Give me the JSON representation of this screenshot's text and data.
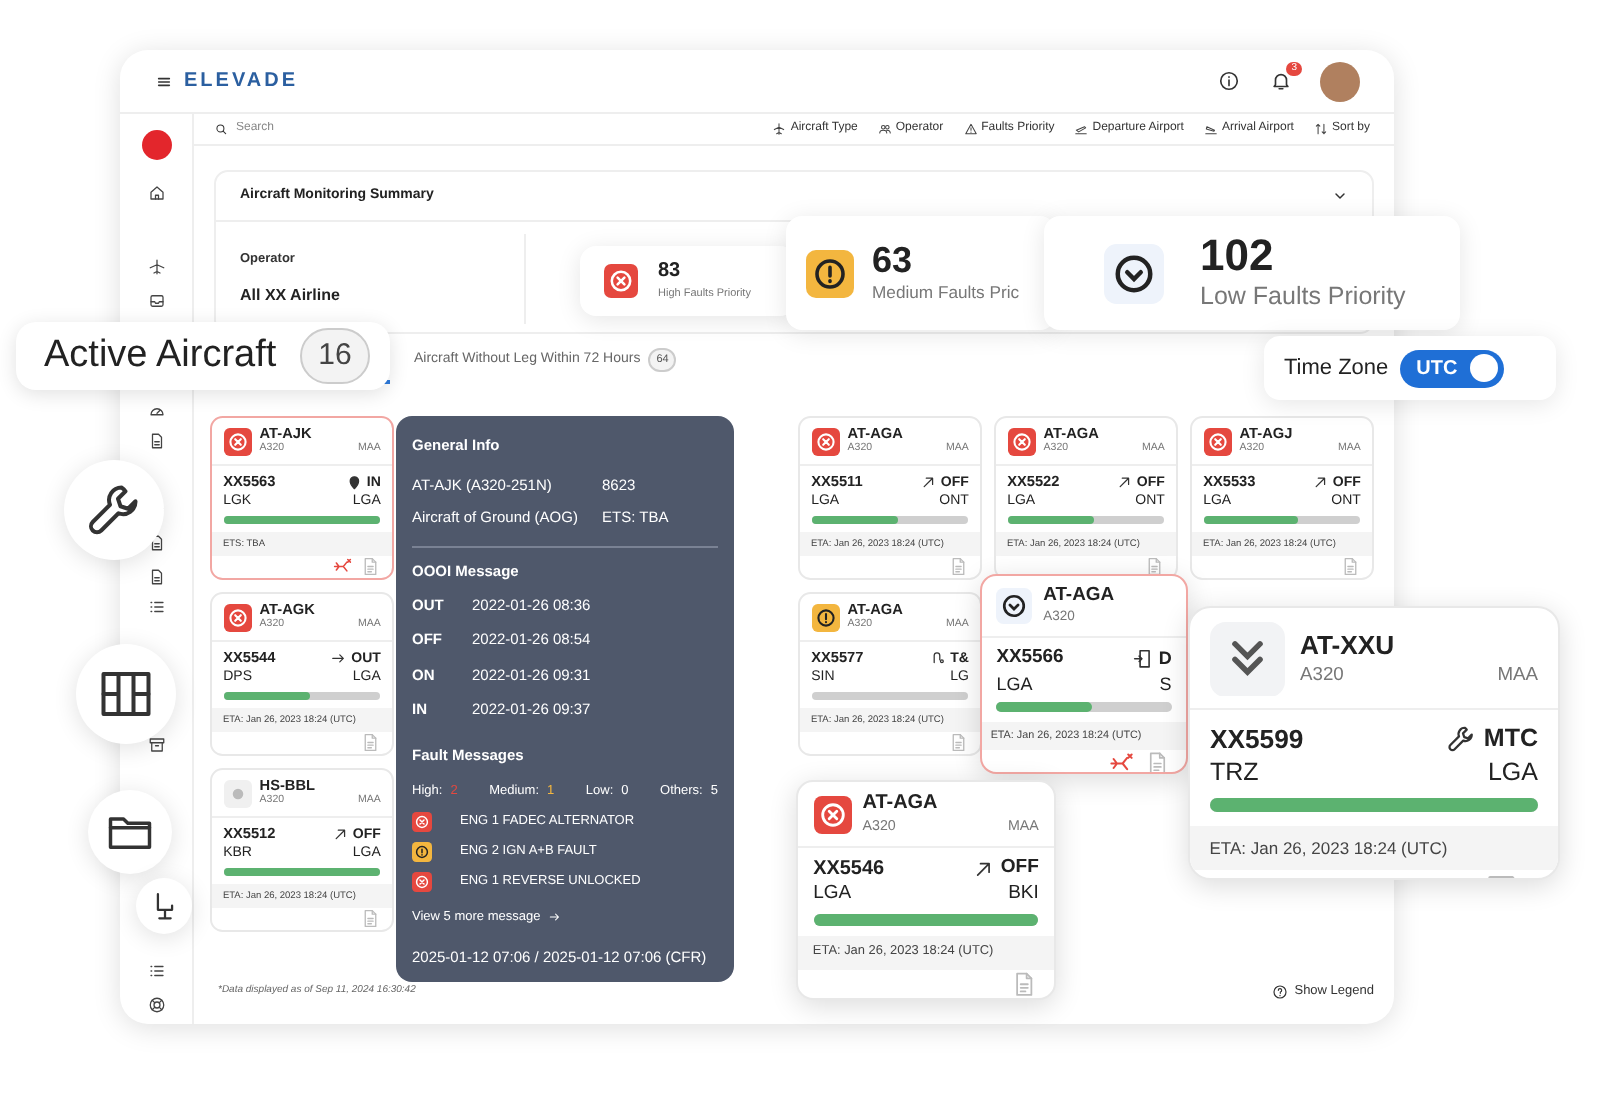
{
  "header": {
    "logo": "ELEVADE",
    "notification_count": "3"
  },
  "search": {
    "placeholder": "Search"
  },
  "filters": [
    {
      "kind": "type",
      "label": "Aircraft Type"
    },
    {
      "kind": "operator",
      "label": "Operator"
    },
    {
      "kind": "priority",
      "label": "Faults Priority"
    },
    {
      "kind": "departure",
      "label": "Departure Airport"
    },
    {
      "kind": "arrival",
      "label": "Arrival Airport"
    },
    {
      "kind": "sort",
      "label": "Sort by"
    }
  ],
  "summary": {
    "title": "Aircraft Monitoring Summary",
    "operator_label": "Operator",
    "operator_value": "All XX Airline"
  },
  "stats": [
    {
      "kind": "high",
      "count": "83",
      "label": "High Faults Priority"
    },
    {
      "kind": "medium",
      "count": "63",
      "label": "Medium Faults Pric"
    },
    {
      "kind": "low",
      "count": "102",
      "label": "Low Faults Priority"
    }
  ],
  "time_zone": {
    "label": "Time Zone",
    "value": "UTC",
    "on": true
  },
  "tabs": [
    {
      "label": "Active Aircraft",
      "count": "16",
      "selected": true
    },
    {
      "label": "Aircraft Without Leg Within 72 Hours",
      "count": "64",
      "selected": false
    }
  ],
  "cards": [
    {
      "kind": "high",
      "registration": "AT-AJK",
      "type": "A320",
      "station": "MAA",
      "flight": "XX5563",
      "status": {
        "kind": "in",
        "label": "IN"
      },
      "origin": "LGK",
      "destination": "LGA",
      "level": 1,
      "eta": "ETS: TBA",
      "alert": true
    },
    {
      "kind": "high",
      "registration": "AT-AGA",
      "type": "A320",
      "station": "MAA",
      "flight": "XX5511",
      "status": {
        "kind": "off",
        "label": "OFF"
      },
      "origin": "LGA",
      "destination": "ONT",
      "level": 0.55,
      "eta": "ETA: Jan 26, 2023 18:24 (UTC)",
      "alert": false
    },
    {
      "kind": "high",
      "registration": "AT-AGA",
      "type": "A320",
      "station": "MAA",
      "flight": "XX5522",
      "status": {
        "kind": "off",
        "label": "OFF"
      },
      "origin": "LGA",
      "destination": "ONT",
      "level": 0.55,
      "eta": "ETA: Jan 26, 2023 18:24 (UTC)",
      "alert": false
    },
    {
      "kind": "high",
      "registration": "AT-AGJ",
      "type": "A320",
      "station": "MAA",
      "flight": "XX5533",
      "status": {
        "kind": "off",
        "label": "OFF"
      },
      "origin": "LGA",
      "destination": "ONT",
      "level": 0.6,
      "eta": "ETA: Jan 26, 2023 18:24 (UTC)",
      "alert": false
    },
    {
      "kind": "high",
      "registration": "AT-AGK",
      "type": "A320",
      "station": "MAA",
      "flight": "XX5544",
      "status": {
        "kind": "out",
        "label": "OUT"
      },
      "origin": "DPS",
      "destination": "LGA",
      "level": 0.55,
      "eta": "ETA: Jan 26, 2023 18:24 (UTC)",
      "alert": false
    },
    {
      "kind": "medium",
      "registration": "AT-AGA",
      "type": "A320",
      "station": "MAA",
      "flight": "XX5577",
      "status": {
        "kind": "touch",
        "label": "T&"
      },
      "origin": "SIN",
      "destination": "LG",
      "level": 0,
      "eta": "ETA: Jan 26, 2023 18:24 (UTC)",
      "alert": false
    },
    {
      "kind": "none",
      "registration": "HS-BBL",
      "type": "A320",
      "station": "MAA",
      "flight": "XX5512",
      "status": {
        "kind": "off",
        "label": "OFF"
      },
      "origin": "KBR",
      "destination": "LGA",
      "level": 1,
      "eta": "ETA: Jan 26, 2023 18:24 (UTC)",
      "alert": false
    }
  ],
  "featured_cards": [
    {
      "kind": "low",
      "registration": "AT-AGA",
      "type": "A320",
      "flight": "XX5566",
      "status": {
        "kind": "door",
        "label": "D"
      },
      "origin": "LGA",
      "destination": "S",
      "level": 0.55,
      "eta": "ETA: Jan 26, 2023 18:24 (UTC)",
      "alert": true
    },
    {
      "kind": "high",
      "registration": "AT-AGA",
      "type": "A320",
      "station": "MAA",
      "flight": "XX5546",
      "status": {
        "kind": "off",
        "label": "OFF"
      },
      "origin": "LGA",
      "destination": "BKI",
      "level": 1,
      "eta": "ETA: Jan 26, 2023 18:24 (UTC)",
      "alert": false
    },
    {
      "kind": "lowest",
      "registration": "AT-XXU",
      "type": "A320",
      "station": "MAA",
      "flight": "XX5599",
      "status": {
        "kind": "mtc",
        "label": "MTC"
      },
      "origin": "TRZ",
      "destination": "LGA",
      "level": 1,
      "eta": "ETA: Jan 26, 2023 18:24 (UTC)",
      "alert": false
    }
  ],
  "tooltip": {
    "title": "General Info",
    "aircraft": "AT-AJK (A320-251N)",
    "msn": "8623",
    "state": "Aircraft of Ground (AOG)",
    "ets": "ETS:  TBA",
    "oooi_title": "OOOI Message",
    "oooi": [
      {
        "label": "OUT",
        "time": "2022-01-26 08:36"
      },
      {
        "label": "OFF",
        "time": "2022-01-26 08:54"
      },
      {
        "label": "ON",
        "time": "2022-01-26 09:31"
      },
      {
        "label": "IN",
        "time": "2022-01-26 09:37"
      }
    ],
    "fault_title": "Fault Messages",
    "fault_counts": [
      {
        "label": "High:",
        "value": "2",
        "color": "#e5483f"
      },
      {
        "label": "Medium:",
        "value": "1",
        "color": "#f3b63f"
      },
      {
        "label": "Low:",
        "value": "0",
        "color": "#ffffff"
      },
      {
        "label": "Others:",
        "value": "5",
        "color": "#ffffff"
      }
    ],
    "faults": [
      {
        "kind": "high",
        "text": "ENG 1 FADEC ALTERNATOR"
      },
      {
        "kind": "medium",
        "text": "ENG 2 IGN A+B FAULT"
      },
      {
        "kind": "high",
        "text": "ENG 1 REVERSE UNLOCKED"
      }
    ],
    "more_link": "View 5 more message",
    "timestamp": "2025-01-12 07:06 / 2025-01-12 07:06 (CFR)"
  },
  "footnote": "*Data displayed as of Sep 11, 2024 16:30:42",
  "legend_link": "Show Legend"
}
